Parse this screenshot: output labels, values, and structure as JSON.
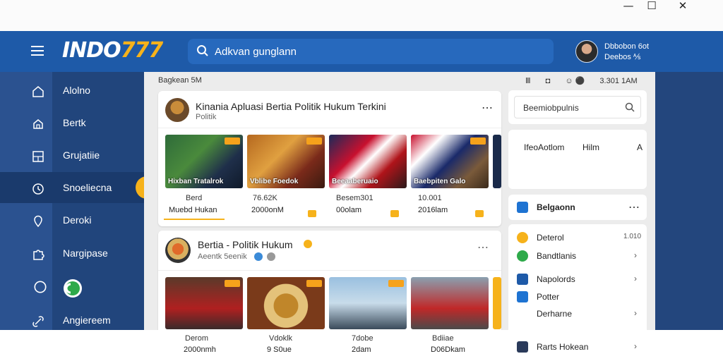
{
  "window": {
    "minimize": "—",
    "maximize": "☐",
    "close": "✕"
  },
  "header": {
    "logo_text": "INDO",
    "logo_num": "777",
    "search_placeholder": "Adkvan gunglann",
    "user_name": "Dbbobon 6ot",
    "user_sub": "Deebos ⅍"
  },
  "sidebar": {
    "items": [
      {
        "label": "Alolno",
        "icon": "home-icon"
      },
      {
        "label": "Bertk",
        "icon": "home-outline-icon"
      },
      {
        "label": "Grujatiie",
        "icon": "grid-icon"
      },
      {
        "label": "Snoeliecna",
        "icon": "clock-icon"
      },
      {
        "label": "Deroki",
        "icon": "pin-icon"
      },
      {
        "label": "Nargipase",
        "icon": "puzzle-icon"
      },
      {
        "label": "",
        "icon": "toggle-icon"
      },
      {
        "label": "Angiereem",
        "icon": "link-icon"
      }
    ]
  },
  "main": {
    "breadcrumb": "Bagkean   5M",
    "status": [
      "Ⅲ",
      "◘",
      "☺ ⚫",
      "3.301   1AM"
    ],
    "card1": {
      "title": "Kinania Apluasi Bertia Politik Hukum Terkini",
      "subtitle": "Politik",
      "news": [
        {
          "caption": "Hixban Tratalrok",
          "meta1": "Berd",
          "meta2": "Muebd Hukan"
        },
        {
          "caption": "Vblibe Foedok",
          "meta1": "76.62K",
          "meta2": "2000onM"
        },
        {
          "caption": "Beeaaberuaio",
          "meta1": "Besem301",
          "meta2": "00olam"
        },
        {
          "caption": "Baebpiten Galo",
          "meta1": "10.001",
          "meta2": "2016lam"
        }
      ]
    },
    "card2": {
      "title": "Bertia - Politik Hukum",
      "subtitle": "Aeentk 5eenik",
      "news": [
        {
          "meta1": "Derom",
          "meta2": "2000nmh"
        },
        {
          "meta1": "Vdoklk",
          "meta2": "9 S0ue"
        },
        {
          "meta1": "7dobe",
          "meta2": "2dam"
        },
        {
          "meta1": "Bdiiae",
          "meta2": "D06Dkam"
        }
      ]
    }
  },
  "right_panel": {
    "search_placeholder": "Beemiobpulnis",
    "info_row": [
      "IfeoAotlom",
      "Hilm",
      "A"
    ],
    "section_title": "Belgaonn",
    "items": [
      {
        "label": "Deterol",
        "value": "1.010"
      },
      {
        "label": "Bandtlanis",
        "value": "›"
      },
      {
        "label": "Napolords",
        "value": "›"
      },
      {
        "label": "Potter",
        "value": ""
      },
      {
        "label": "Derharne",
        "value": "›"
      },
      {
        "label": "Rarts Hokean",
        "value": "›"
      }
    ]
  },
  "colors": {
    "header": "#1e5aa8",
    "sidebar": "#21457c",
    "accent": "#f6b21b"
  }
}
